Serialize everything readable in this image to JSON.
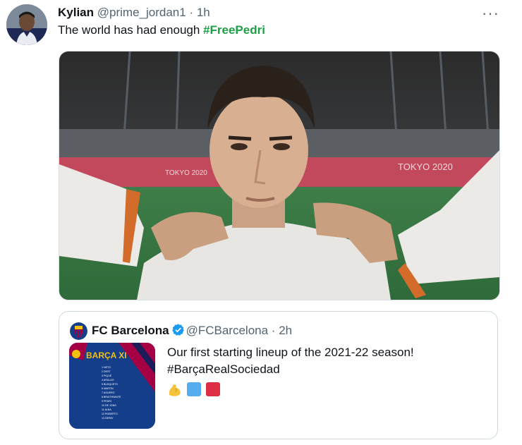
{
  "tweet": {
    "author_name": "Kylian",
    "handle": "@prime_jordan1",
    "separator": "·",
    "time": "1h",
    "more_icon": "more-horizontal-icon",
    "text": "The world has had enough ",
    "hashtag": "#FreePedri"
  },
  "media": {
    "stadium_text_left": "TOKYO 2020",
    "stadium_text_right": "TOKYO 2020"
  },
  "quote": {
    "author_name": "FC Barcelona",
    "verified_icon": "verified-badge-icon",
    "handle": "@FCBarcelona",
    "separator": "·",
    "time": "2h",
    "line1": "Our first starting lineup of the 2021-22 season!",
    "line2": "#BarçaRealSociedad",
    "emojis": [
      "flexed-biceps",
      "blue-square",
      "red-square"
    ],
    "thumbnail": {
      "title": "BARÇA XI",
      "players": [
        "1 NETO",
        "2 DEST",
        "3 PIQUÉ",
        "4 ARAUJO",
        "5 BUSQUETS",
        "6 MARTIN",
        "7 AGUERO",
        "8 BRAITHWAITE",
        "9 PEDRI",
        "10 DE JONG",
        "11 ALBA",
        "12 ROBERTO",
        "13 DEPAY"
      ]
    }
  },
  "colors": {
    "hashtag_green": "#1da045",
    "muted_text": "#536471",
    "verified_blue": "#1d9bf0",
    "barca_blue": "#143d8a",
    "barca_red": "#a50044",
    "square_blue": "#55acee",
    "square_red": "#dd2e44"
  }
}
